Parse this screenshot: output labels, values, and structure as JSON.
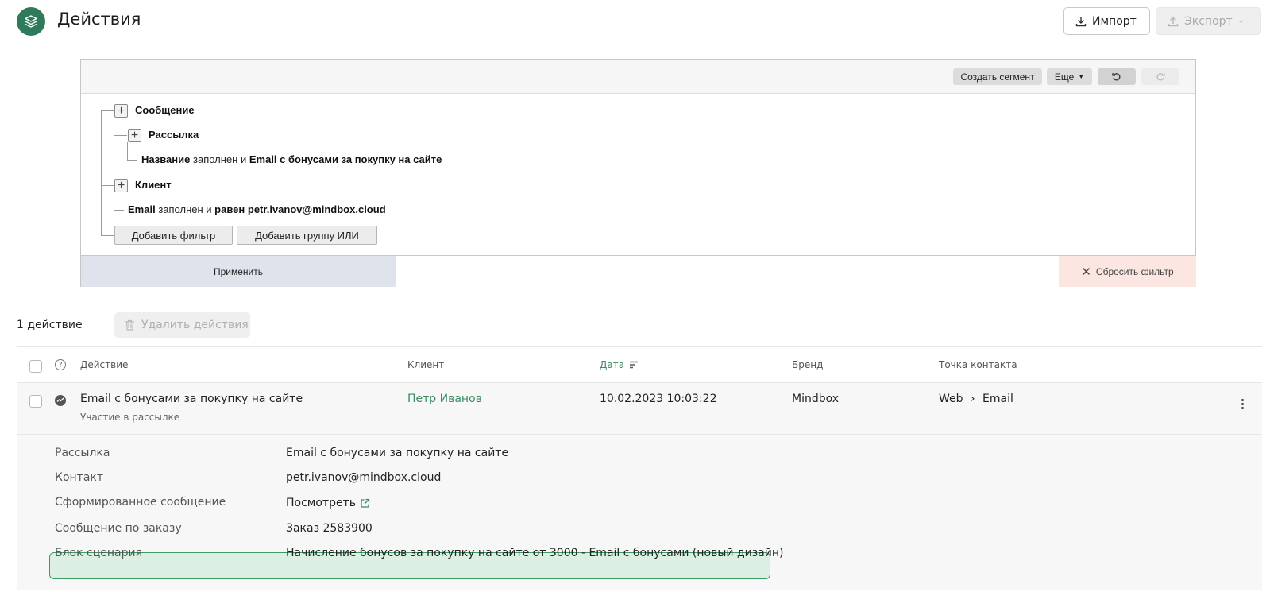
{
  "header": {
    "title": "Действия",
    "import_label": "Импорт",
    "export_label": "Экспорт"
  },
  "filter": {
    "toolbar": {
      "create_segment": "Создать сегмент",
      "more": "Еще"
    },
    "tree": {
      "group1_label": "Сообщение",
      "group1_child_label": "Рассылка",
      "cond1": {
        "field": "Название",
        "op1": "заполнен и",
        "value": "Email с бонусами за покупку на сайте"
      },
      "group2_label": "Клиент",
      "cond2": {
        "field": "Email",
        "op1": "заполнен и",
        "op2": "равен",
        "value": "petr.ivanov@mindbox.cloud"
      }
    },
    "add_filter": "Добавить фильтр",
    "add_or_group": "Добавить группу ИЛИ",
    "apply": "Применить",
    "reset": "Сбросить фильтр"
  },
  "actions": {
    "count": "1 действие",
    "delete_label": "Удалить действия",
    "columns": {
      "action": "Действие",
      "client": "Клиент",
      "date": "Дата",
      "brand": "Бренд",
      "contact_point": "Точка контакта"
    },
    "row": {
      "title": "Email с бонусами за покупку на сайте",
      "subtitle": "Участие в рассылке",
      "client": "Петр Иванов",
      "date": "10.02.2023 10:03:22",
      "brand": "Mindbox",
      "contact_from": "Web",
      "contact_sep": "›",
      "contact_to": "Email"
    },
    "details": [
      {
        "label": "Рассылка",
        "value": "Email с бонусами за покупку на сайте"
      },
      {
        "label": "Контакт",
        "value": "petr.ivanov@mindbox.cloud"
      },
      {
        "label": "Сформированное сообщение",
        "value": "Посмотреть"
      },
      {
        "label": "Сообщение по заказу",
        "value": "Заказ 2583900"
      },
      {
        "label": "Блок сценария",
        "value": "Начисление бонусов за покупку на сайте от 3000 - Email с бонусами (новый дизайн)"
      }
    ]
  },
  "colors": {
    "accent": "#2f7a5a",
    "link": "#3d8b63",
    "highlight_bg": "#dcefe3",
    "reset_bg": "#fbe6e1",
    "apply_bg": "#dfe4ec"
  }
}
